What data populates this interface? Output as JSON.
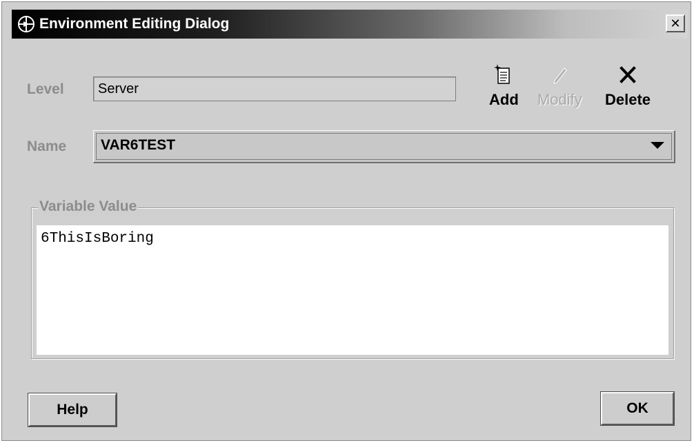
{
  "window": {
    "title": "Environment Editing Dialog",
    "close_symbol": "✕"
  },
  "form": {
    "level_label": "Level",
    "level_value": "Server",
    "name_label": "Name",
    "name_value": "VAR6TEST"
  },
  "toolbar": {
    "add_label": "Add",
    "modify_label": "Modify",
    "delete_label": "Delete"
  },
  "variable_value": {
    "legend": "Variable Value",
    "text": "6ThisIsBoring"
  },
  "buttons": {
    "help_label": "Help",
    "ok_label": "OK"
  },
  "icons": {
    "title": "app-globe-icon",
    "add": "new-document-icon",
    "modify": "pencil-icon",
    "delete": "x-delete-icon",
    "dropdown": "dropdown-arrow-icon"
  }
}
